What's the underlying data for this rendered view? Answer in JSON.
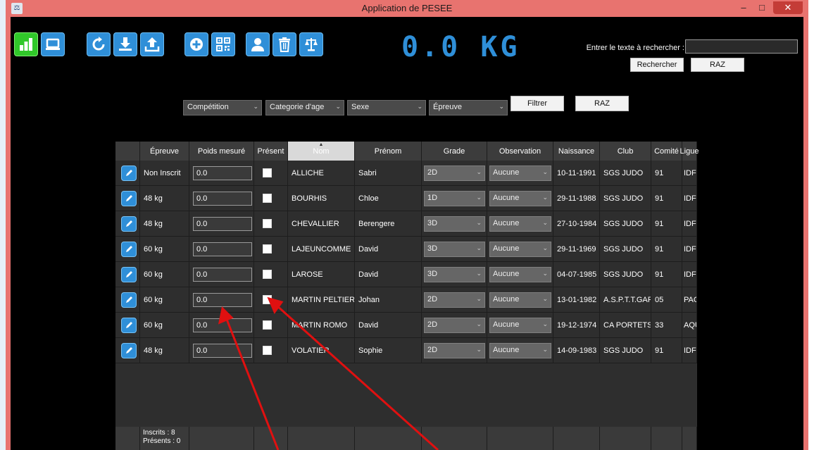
{
  "window": {
    "title": "Application de PESEE",
    "min_glyph": "–",
    "max_glyph": "□",
    "close_glyph": "✕"
  },
  "toolbar": {
    "buttons": [
      {
        "name": "stats-icon"
      },
      {
        "name": "laptop-icon"
      },
      {
        "name": "refresh-icon"
      },
      {
        "name": "download-icon"
      },
      {
        "name": "upload-icon"
      },
      {
        "name": "add-icon"
      },
      {
        "name": "qr-code-icon"
      },
      {
        "name": "user-icon"
      },
      {
        "name": "trash-icon"
      },
      {
        "name": "scale-icon"
      }
    ]
  },
  "weight_display": "0.0 KG",
  "search": {
    "label": "Entrer le texte à rechercher :",
    "value": "",
    "search_button": "Rechercher",
    "reset_button": "RAZ"
  },
  "filters": {
    "competition": "Compétition",
    "age_category": "Categorie d'age",
    "sex": "Sexe",
    "event": "Épreuve",
    "filter_button": "Filtrer",
    "reset_button": "RAZ"
  },
  "columns": [
    "",
    "Épreuve",
    "Poids mesuré",
    "Présent",
    "Nom",
    "Prénom",
    "Grade",
    "Observation",
    "Naissance",
    "Club",
    "Comité",
    "Ligue"
  ],
  "rows": [
    {
      "epreuve": "Non Inscrit",
      "poids": "0.0",
      "nom": "ALLICHE",
      "prenom": "Sabri",
      "grade": "2D",
      "observation": "Aucune",
      "naissance": "10-11-1991",
      "club": "SGS JUDO",
      "comite": "91",
      "ligue": "IDF"
    },
    {
      "epreuve": "48 kg",
      "poids": "0.0",
      "nom": "BOURHIS",
      "prenom": "Chloe",
      "grade": "1D",
      "observation": "Aucune",
      "naissance": "29-11-1988",
      "club": "SGS JUDO",
      "comite": "91",
      "ligue": "IDF"
    },
    {
      "epreuve": "48 kg",
      "poids": "0.0",
      "nom": "CHEVALLIER",
      "prenom": "Berengere",
      "grade": "3D",
      "observation": "Aucune",
      "naissance": "27-10-1984",
      "club": "SGS JUDO",
      "comite": "91",
      "ligue": "IDF"
    },
    {
      "epreuve": "60 kg",
      "poids": "0.0",
      "nom": "LAJEUNCOMME",
      "prenom": "David",
      "grade": "3D",
      "observation": "Aucune",
      "naissance": "29-11-1969",
      "club": "SGS JUDO",
      "comite": "91",
      "ligue": "IDF"
    },
    {
      "epreuve": "60 kg",
      "poids": "0.0",
      "nom": "LAROSE",
      "prenom": "David",
      "grade": "3D",
      "observation": "Aucune",
      "naissance": "04-07-1985",
      "club": "SGS JUDO",
      "comite": "91",
      "ligue": "IDF"
    },
    {
      "epreuve": "60 kg",
      "poids": "0.0",
      "nom": "MARTIN PELTIER",
      "prenom": "Johan",
      "grade": "2D",
      "observation": "Aucune",
      "naissance": "13-01-1982",
      "club": "A.S.P.T.T.GAP",
      "comite": "05",
      "ligue": "PACA"
    },
    {
      "epreuve": "60 kg",
      "poids": "0.0",
      "nom": "MARTIN ROMO",
      "prenom": "David",
      "grade": "2D",
      "observation": "Aucune",
      "naissance": "19-12-1974",
      "club": "CA PORTETS",
      "comite": "33",
      "ligue": "AQU"
    },
    {
      "epreuve": "48 kg",
      "poids": "0.0",
      "nom": "VOLATIER",
      "prenom": "Sophie",
      "grade": "2D",
      "observation": "Aucune",
      "naissance": "14-09-1983",
      "club": "SGS JUDO",
      "comite": "91",
      "ligue": "IDF"
    }
  ],
  "footer": {
    "inscrits": "Inscrits : 8",
    "presents": "Présents : 0"
  },
  "colors": {
    "accent_blue": "#2f8fd8",
    "active_green": "#31c82a",
    "frame": "#e8736f",
    "annotation_arrow": "#e01010"
  }
}
